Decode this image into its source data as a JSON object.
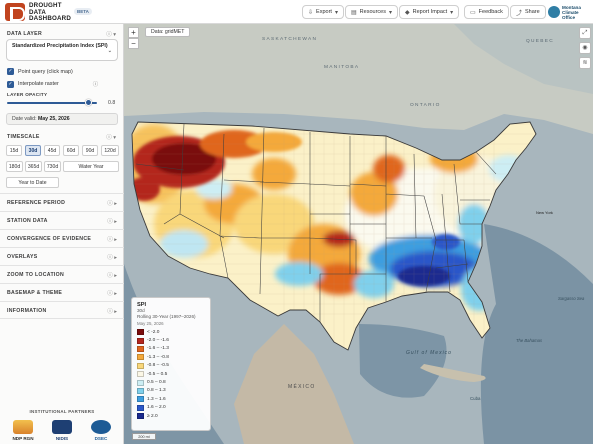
{
  "header": {
    "brand_lines": [
      "DROUGHT",
      "DATA",
      "DASHBOARD"
    ],
    "beta": "BETA",
    "export": "Export",
    "resources": "Resources",
    "report_impact": "Report Impact",
    "feedback": "Feedback",
    "share": "Share",
    "partner_logo_lines": [
      "Montana",
      "Climate",
      "Office"
    ]
  },
  "sidebar": {
    "data_layer_title": "DATA LAYER",
    "layer_name": "Standardized Precipitation Index (SPI)",
    "point_query": "Point query (click map)",
    "interpolate": "Interpolate raster",
    "opacity_title": "LAYER OPACITY",
    "opacity_value": "0.8",
    "opacity_fraction": 0.8,
    "date_label": "Date valid:",
    "date_value": "May 25, 2026",
    "timescale_title": "TIMESCALE",
    "timescales_row1": [
      "15d",
      "30d",
      "45d",
      "60d",
      "90d",
      "120d"
    ],
    "timescales_row2": [
      "180d",
      "365d",
      "730d",
      "Water Year"
    ],
    "timescales_row3": [
      "Year to Date"
    ],
    "active_timescale": "30d",
    "sections": [
      "REFERENCE PERIOD",
      "STATION DATA",
      "CONVERGENCE OF EVIDENCE",
      "OVERLAYS",
      "ZOOM TO LOCATION",
      "BASEMAP & THEME",
      "INFORMATION"
    ],
    "partners_title": "INSTITUTIONAL PARTNERS",
    "partners": [
      "NDP RGN",
      "NIDIS",
      "DSEC"
    ]
  },
  "map": {
    "data_source": "Data: gridMET",
    "zoom_in": "+",
    "zoom_out": "−",
    "labels": {
      "saskatchewan": "SASKATCHEWAN",
      "manitoba": "MANITOBA",
      "quebec": "QUEBEC",
      "ontario": "ONTARIO",
      "gulf": "Gulf of Mexico",
      "mexico": "MÉXICO",
      "bahamas": "The Bahamas",
      "cuba": "Cuba",
      "sargasso": "Sargasso Sea",
      "new_york": "New York"
    },
    "scale": "200 mi"
  },
  "legend": {
    "title": "SPI",
    "timescale": "30d",
    "period": "Rolling 30-Year (1997–2026)",
    "date": "May 25, 2026",
    "items": [
      {
        "label": "< -2.0",
        "color": "#7a0b0b"
      },
      {
        "label": "-2.0 – -1.6",
        "color": "#b3261e"
      },
      {
        "label": "-1.6 – -1.3",
        "color": "#e0661f"
      },
      {
        "label": "-1.3 – -0.8",
        "color": "#f4a93b"
      },
      {
        "label": "-0.8 – -0.5",
        "color": "#f9d77a"
      },
      {
        "label": "-0.5 – 0.5",
        "color": "#fbf7e6"
      },
      {
        "label": "0.5 – 0.8",
        "color": "#cdeef4"
      },
      {
        "label": "0.8 – 1.3",
        "color": "#7fd0ec"
      },
      {
        "label": "1.3 – 1.6",
        "color": "#3c9ee0"
      },
      {
        "label": "1.6 – 2.0",
        "color": "#2a57c9"
      },
      {
        "label": "≥ 2.0",
        "color": "#1a2a8f"
      }
    ]
  }
}
